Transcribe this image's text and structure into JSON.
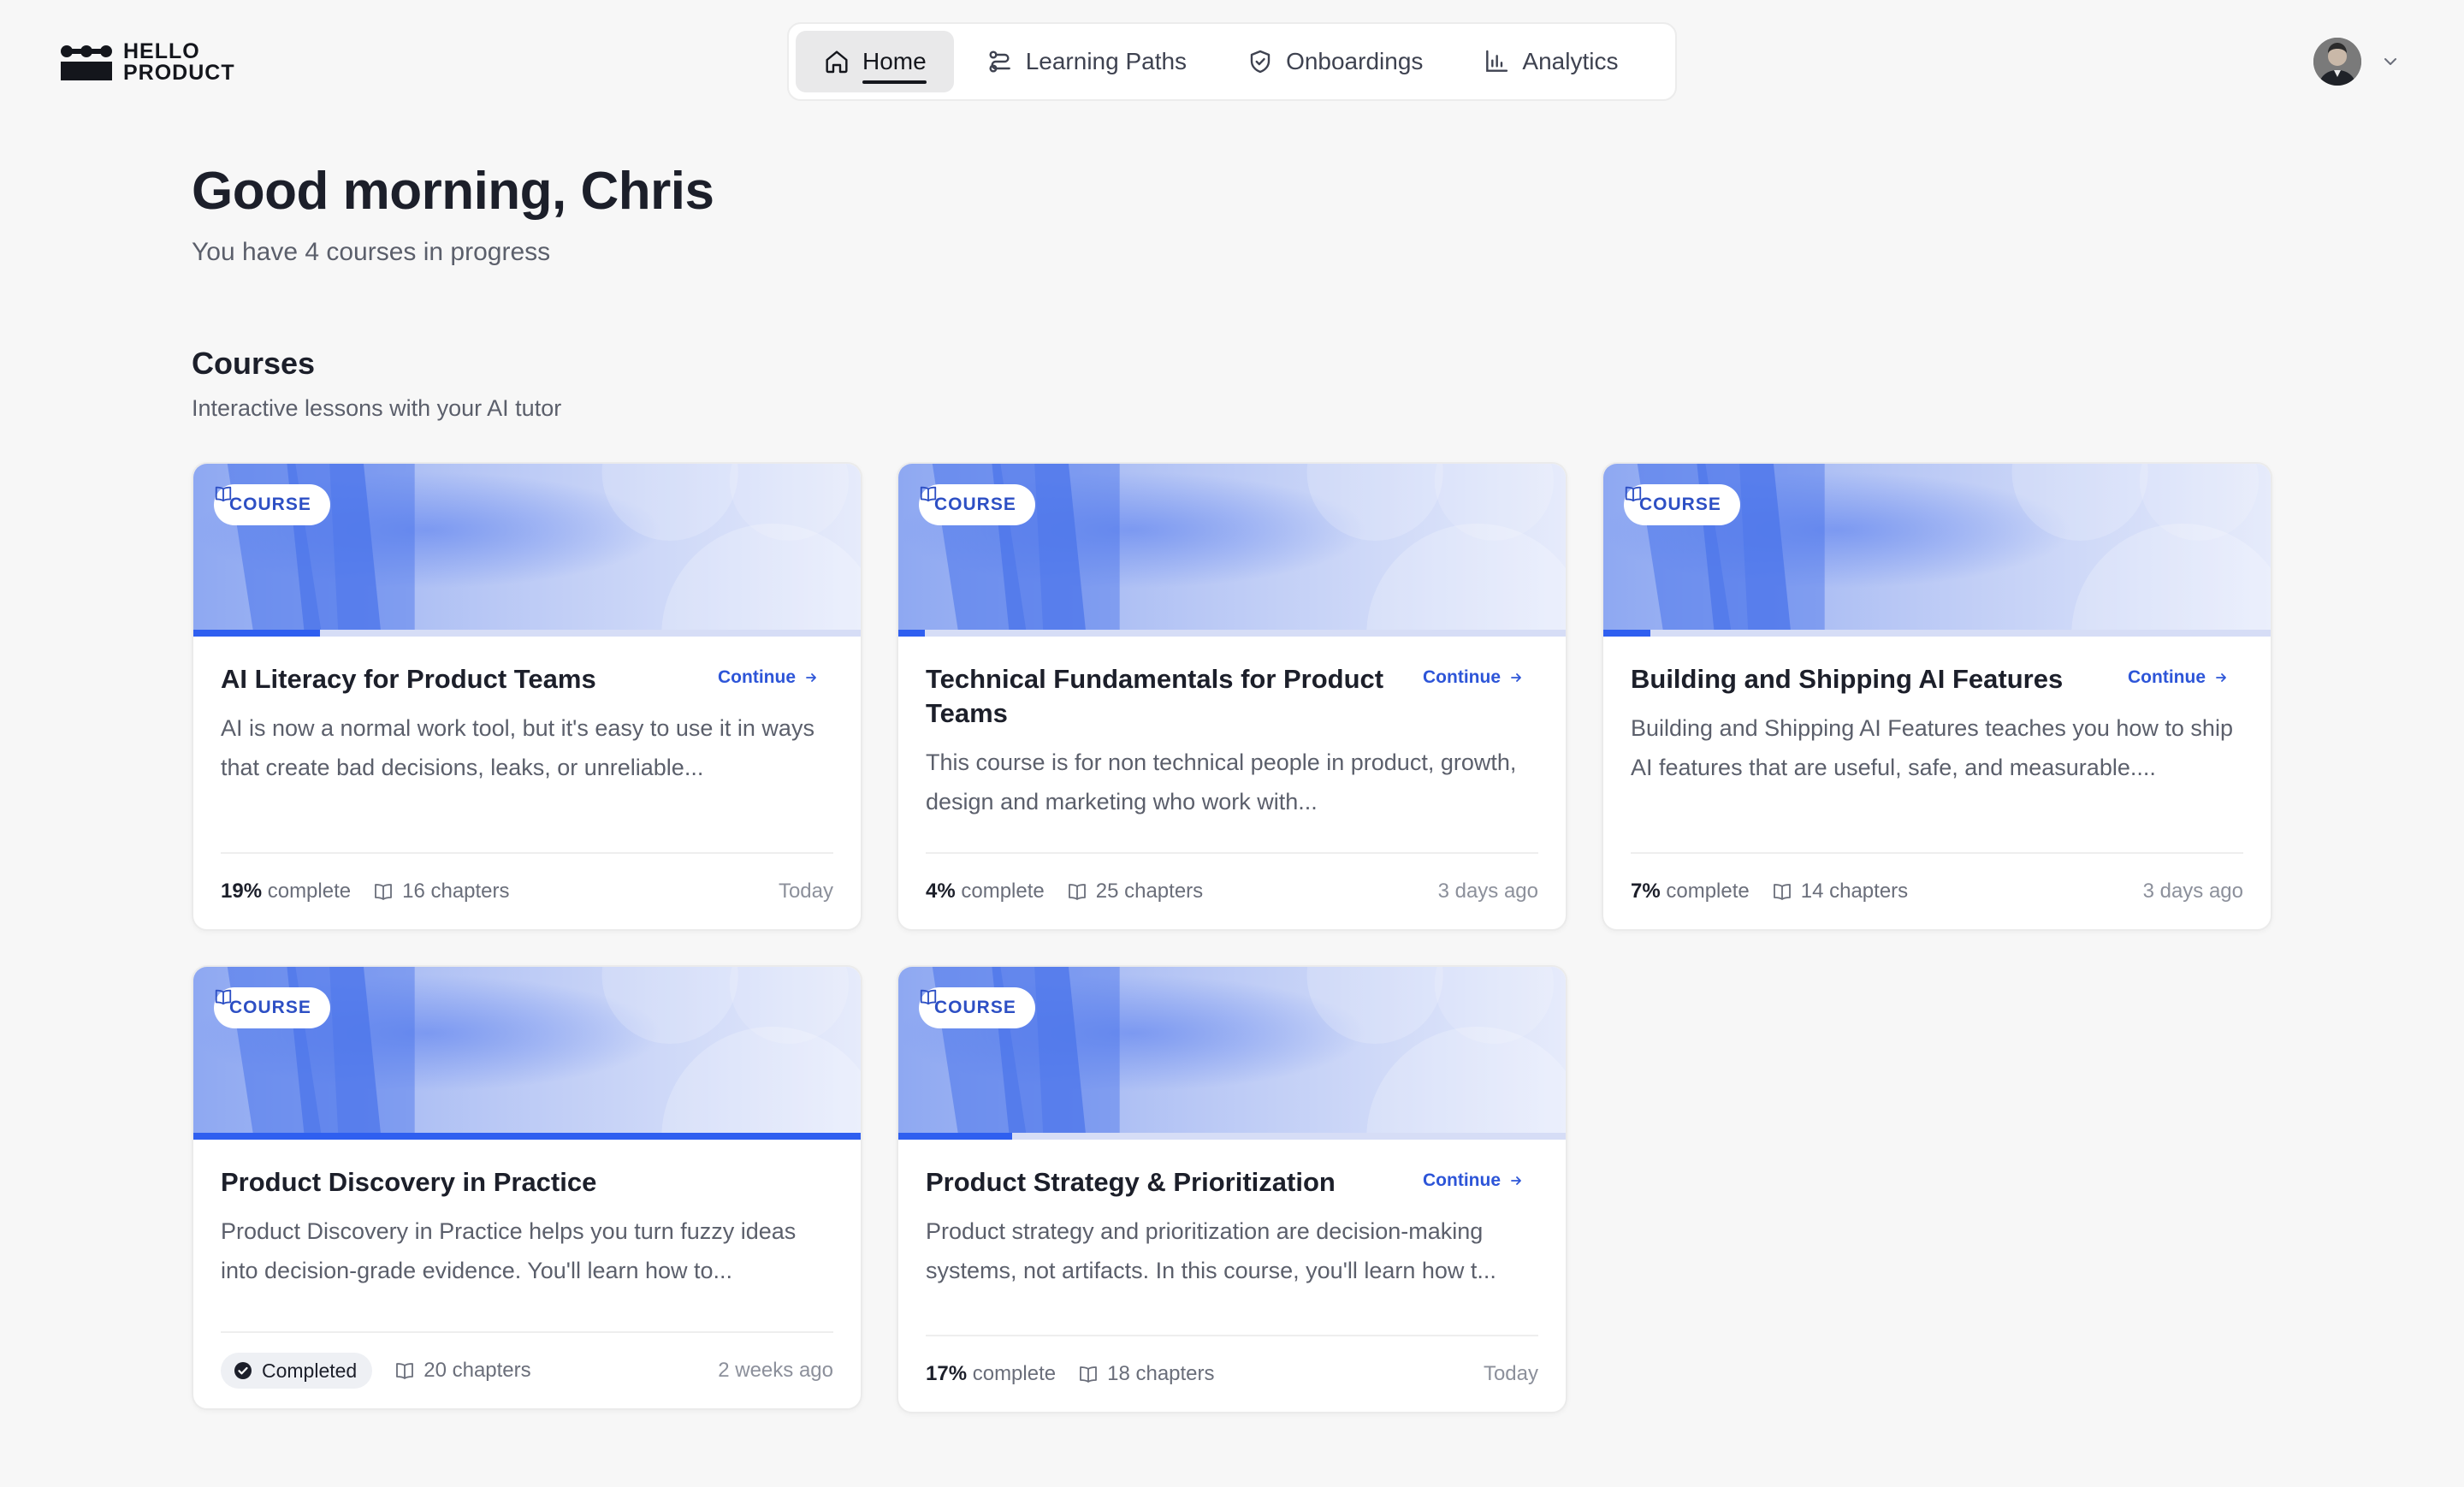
{
  "brand": {
    "line1": "HELLO",
    "line2": "PRODUCT"
  },
  "nav": [
    {
      "label": "Home",
      "icon": "home-icon",
      "active": true
    },
    {
      "label": "Learning Paths",
      "icon": "route-icon",
      "active": false
    },
    {
      "label": "Onboardings",
      "icon": "shield-check-icon",
      "active": false
    },
    {
      "label": "Analytics",
      "icon": "bar-chart-icon",
      "active": false
    }
  ],
  "account": {
    "avatar_icon": "user-avatar",
    "menu_icon": "chevron-down-icon"
  },
  "greeting": {
    "title": "Good morning, Chris",
    "subtitle": "You have 4 courses in progress"
  },
  "courses_section": {
    "title": "Courses",
    "subtitle": "Interactive lessons with your AI tutor"
  },
  "colors": {
    "accent": "#2f5ff0",
    "banner_light": "#e6ebfb",
    "banner_mid": "#8ea8f2",
    "banner_dark": "#4a74ea",
    "background": "#f7f7f7"
  },
  "courses": [
    {
      "badge": "COURSE",
      "title": "AI Literacy for Product Teams",
      "continue_label": "Continue",
      "description": "AI is now a normal work tool, but it's easy to use it in ways that create bad decisions, leaks, or unreliable...",
      "progress": 19,
      "progress_label": "19%",
      "complete_label": "complete",
      "chapters": "16 chapters",
      "updated": "Today"
    },
    {
      "badge": "COURSE",
      "title": "Technical Fundamentals for Product Teams",
      "continue_label": "Continue",
      "description": "This course is for non technical people in product, growth, design and marketing who work with...",
      "progress": 4,
      "progress_label": "4%",
      "complete_label": "complete",
      "chapters": "25 chapters",
      "updated": "3 days ago"
    },
    {
      "badge": "COURSE",
      "title": "Building and Shipping AI Features",
      "continue_label": "Continue",
      "description": "Building and Shipping AI Features teaches you how to ship AI features that are useful, safe, and measurable....",
      "progress": 7,
      "progress_label": "7%",
      "complete_label": "complete",
      "chapters": "14 chapters",
      "updated": "3 days ago"
    },
    {
      "badge": "COURSE",
      "title": "Product Discovery in Practice",
      "description": "Product Discovery in Practice helps you turn fuzzy ideas into decision-grade evidence. You'll learn how to...",
      "progress": 100,
      "completed_label": "Completed",
      "chapters": "20 chapters",
      "updated": "2 weeks ago"
    },
    {
      "badge": "COURSE",
      "title": "Product Strategy & Prioritization",
      "continue_label": "Continue",
      "description": "Product strategy and prioritization are decision-making systems, not artifacts. In this course, you'll learn how t...",
      "progress": 17,
      "progress_label": "17%",
      "complete_label": "complete",
      "chapters": "18 chapters",
      "updated": "Today"
    }
  ]
}
